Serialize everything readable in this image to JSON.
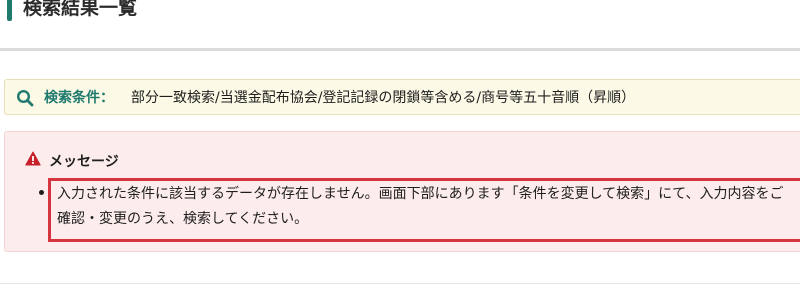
{
  "header": {
    "title": "検索結果一覧",
    "accent_color": "#1f7a6e"
  },
  "search_conditions": {
    "icon": "search-icon",
    "label": "検索条件：",
    "value": "部分一致検索/当選金配布協会/登記記録の閉鎖等含める/商号等五十音順（昇順）",
    "label_color": "#1f7a6e",
    "background": "#fcf9e6"
  },
  "message": {
    "icon": "warning-icon",
    "title": "メッセージ",
    "items": [
      "入力された条件に該当するデータが存在しません。画面下部にあります「条件を変更して検索」にて、入力内容をご確認・変更のうえ、検索してください。"
    ],
    "background": "#fdecec",
    "highlight_color": "#d6343f"
  }
}
